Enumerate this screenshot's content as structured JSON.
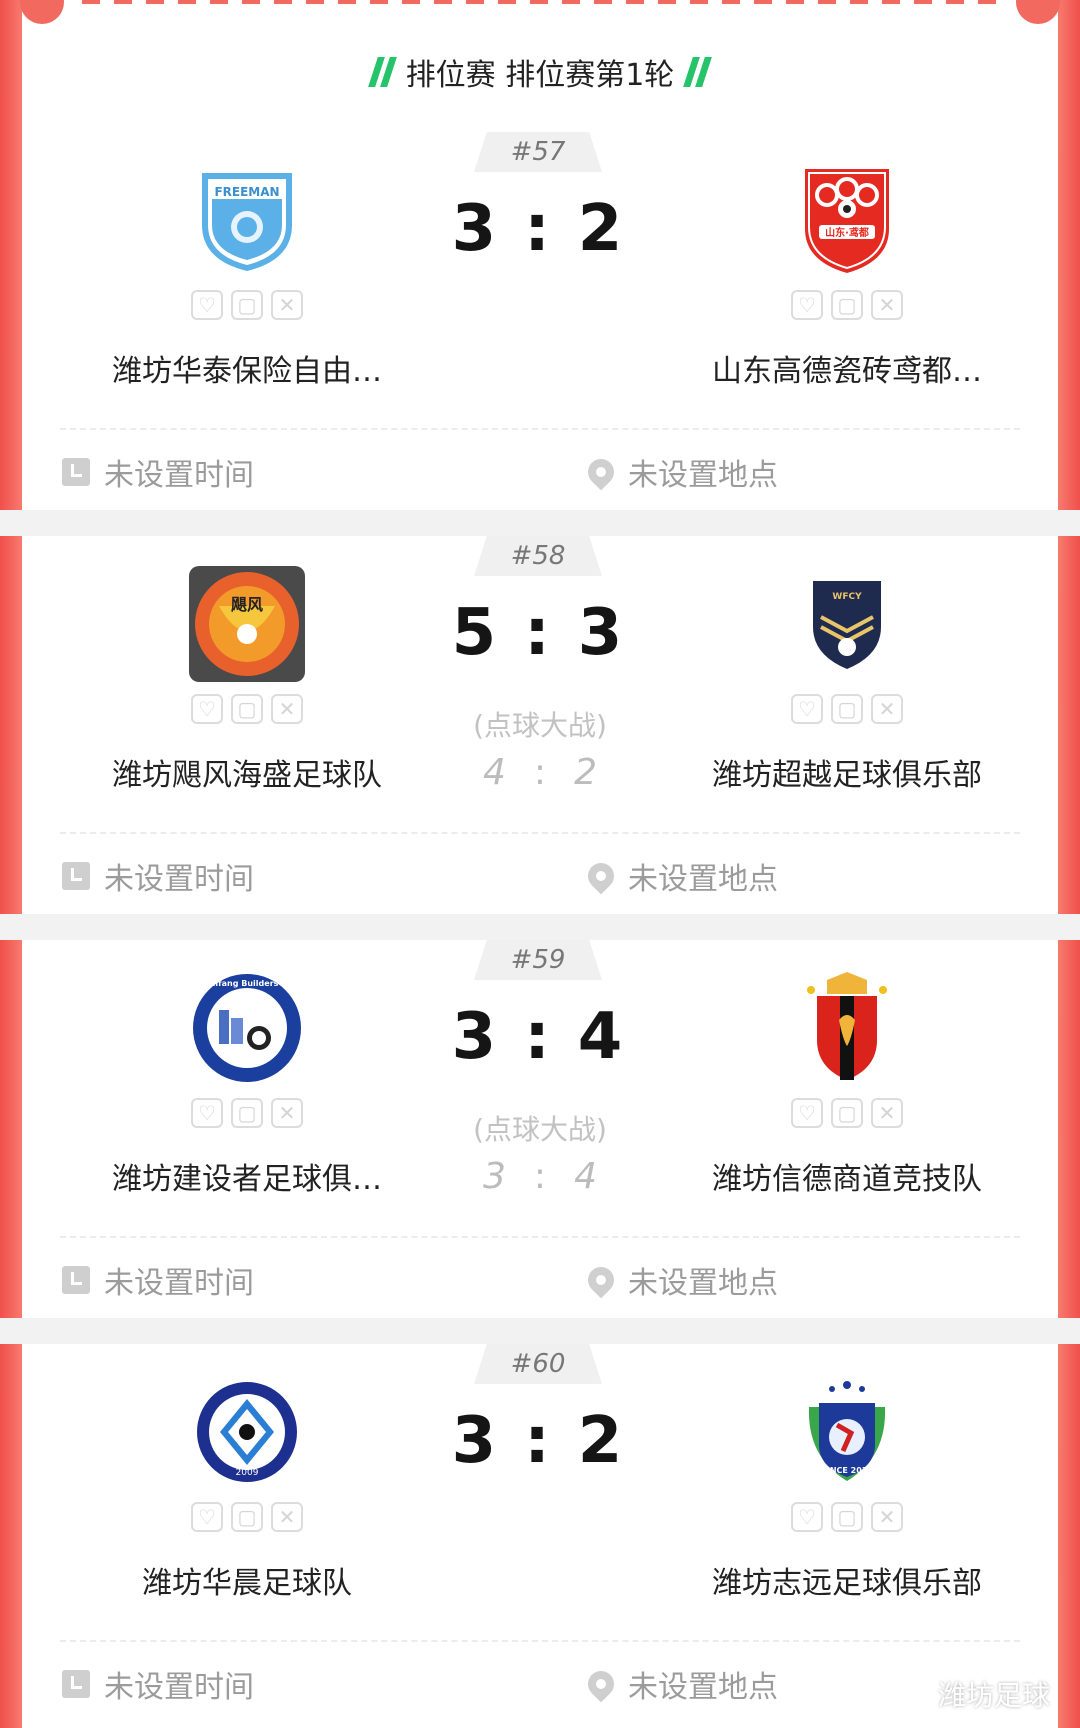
{
  "header": {
    "title": "排位赛 排位赛第1轮"
  },
  "matches": [
    {
      "number": "#57",
      "home": {
        "name": "潍坊华泰保险自由…",
        "logo_text": "FREEMAN"
      },
      "away": {
        "name": "山东高德瓷砖鸢都…",
        "logo_text": "山东·鸢都"
      },
      "score_home": "3",
      "score_away": "2",
      "penalty": null,
      "time": "未设置时间",
      "place": "未设置地点"
    },
    {
      "number": "#58",
      "home": {
        "name": "潍坊飓风海盛足球队",
        "logo_text": "飓风"
      },
      "away": {
        "name": "潍坊超越足球俱乐部",
        "logo_text": "WFCY"
      },
      "score_home": "5",
      "score_away": "3",
      "penalty": {
        "label": "(点球大战)",
        "home": "4",
        "away": "2"
      },
      "time": "未设置时间",
      "place": "未设置地点"
    },
    {
      "number": "#59",
      "home": {
        "name": "潍坊建设者足球俱…",
        "logo_text": "Weifang Builders FC"
      },
      "away": {
        "name": "潍坊信德商道竞技队",
        "logo_text": ""
      },
      "score_home": "3",
      "score_away": "4",
      "penalty": {
        "label": "(点球大战)",
        "home": "3",
        "away": "4"
      },
      "time": "未设置时间",
      "place": "未设置地点"
    },
    {
      "number": "#60",
      "home": {
        "name": "潍坊华晨足球队",
        "logo_text": "2009"
      },
      "away": {
        "name": "潍坊志远足球俱乐部",
        "logo_text": "SINCE 2016"
      },
      "score_home": "3",
      "score_away": "2",
      "penalty": null,
      "time": "未设置时间",
      "place": "未设置地点"
    }
  ],
  "watermark": "潍坊足球",
  "colors": {
    "accent": "#27c36a",
    "border": "#f0504a"
  }
}
